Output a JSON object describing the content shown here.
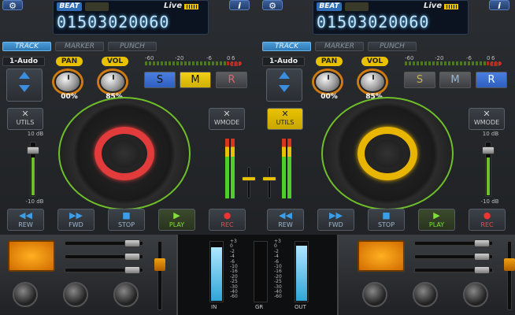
{
  "decks": [
    {
      "id": "left",
      "beat_label": "BEAT",
      "live_label": "Live",
      "timecode": "01503020060",
      "info_label": "i",
      "tabs": [
        "TRACK",
        "MARKER",
        "PUNCH"
      ],
      "active_tab": "TRACK",
      "track_name": "1-Audo",
      "pan_label": "PAN",
      "vol_label": "VOL",
      "pan_value": "00%",
      "vol_value": "85%",
      "s_label": "S",
      "m_label": "M",
      "r_label": "R",
      "utils_label": "UTILS",
      "wmode_label": "WMODE",
      "level_top": "10 dB",
      "level_bottom": "-10 dB",
      "ring_color": "#e23b3b",
      "transport": [
        "REW",
        "FWD",
        "STOP",
        "PLAY",
        "REC"
      ]
    },
    {
      "id": "right",
      "beat_label": "BEAT",
      "live_label": "Live",
      "timecode": "01503020060",
      "info_label": "i",
      "tabs": [
        "TRACK",
        "MARKER",
        "PUNCH"
      ],
      "active_tab": "TRACK",
      "track_name": "1-Audo",
      "pan_label": "PAN",
      "vol_label": "VOL",
      "pan_value": "00%",
      "vol_value": "85%",
      "s_label": "S",
      "m_label": "M",
      "r_label": "R",
      "utils_label": "UTILS",
      "wmode_label": "WMODE",
      "level_top": "10 dB",
      "level_bottom": "-10 dB",
      "ring_color": "#e8b500",
      "transport": [
        "REW",
        "FWD",
        "STOP",
        "PLAY",
        "REC"
      ]
    }
  ],
  "vu_scale": [
    "-60",
    "-20",
    "-6",
    "0",
    "6"
  ],
  "vu_clip": "CLIP",
  "meter_scale": [
    "+3",
    "0",
    "-2",
    "-4",
    "-6",
    "-10",
    "-16",
    "-20",
    "-25",
    "-30",
    "-40",
    "-60"
  ],
  "meter_labels": {
    "in": "IN",
    "gr": "GR",
    "out": "OUT"
  },
  "colors": {
    "accent": "#3a8ee0",
    "yellow": "#e8c200",
    "green": "#6fbf2b",
    "red": "#e23b3b"
  },
  "icons": {
    "settings": "gear-icon",
    "info": "info-icon",
    "utils": "tools-icon",
    "wmode": "wmode-icon"
  }
}
